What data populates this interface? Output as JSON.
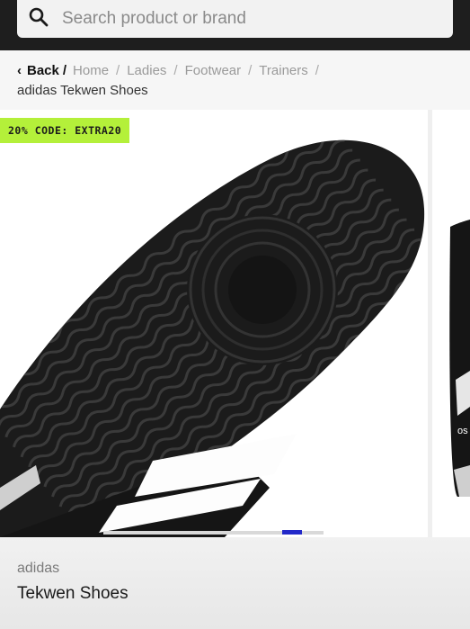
{
  "search": {
    "placeholder": "Search product or brand",
    "icon": "search-icon"
  },
  "breadcrumb": {
    "back_label": "Back",
    "items": [
      "Home",
      "Ladies",
      "Footwear",
      "Trainers"
    ],
    "current": "adidas Tekwen Shoes"
  },
  "gallery": {
    "promo_badge": "20% CODE: EXTRA20",
    "promo_color": "#b4f03a",
    "indicator_color": "#2229c9"
  },
  "product": {
    "brand": "adidas",
    "name": "Tekwen Shoes"
  }
}
